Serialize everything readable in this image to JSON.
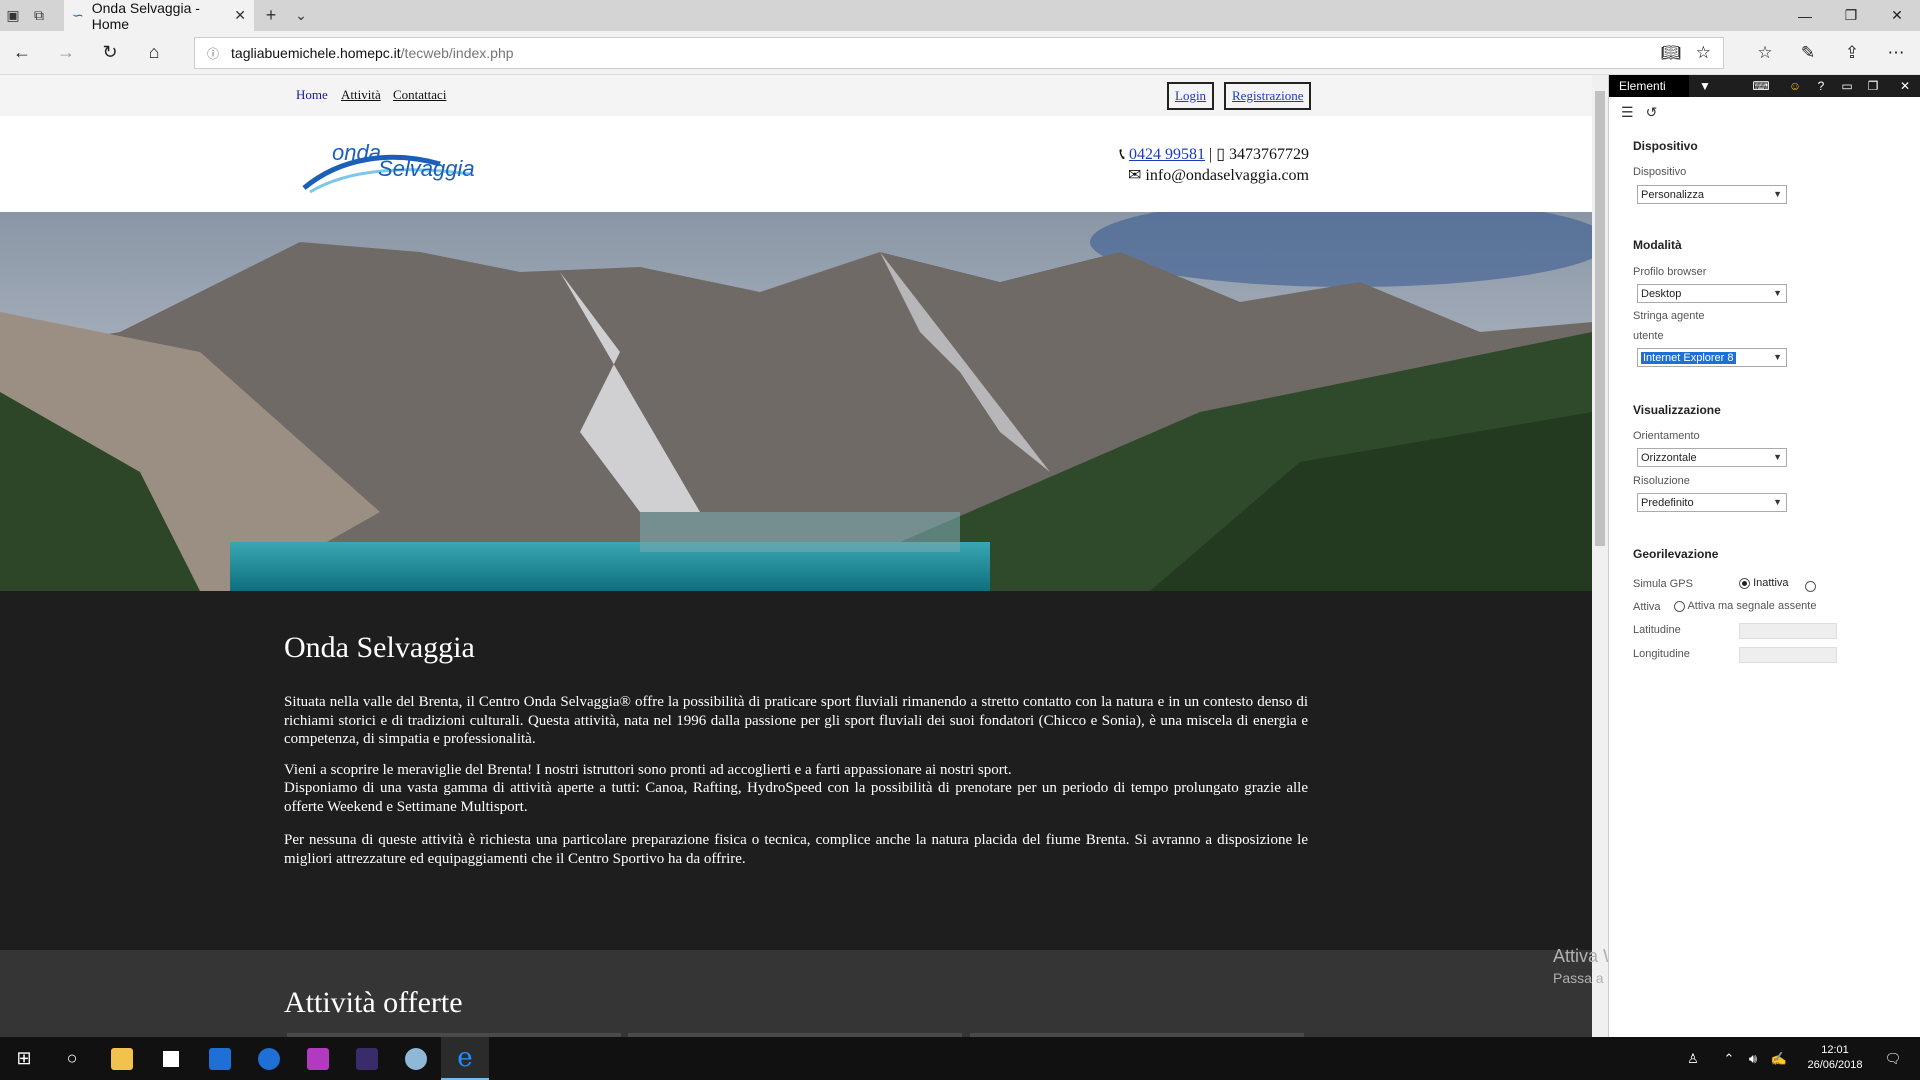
{
  "browser": {
    "tab_title": "Onda Selvaggia - Home",
    "url_host": "tagliabuemichele.homepc.it",
    "url_path": "/tecweb/index.php"
  },
  "site": {
    "nav": {
      "home": "Home",
      "attivita": "Attività",
      "contattaci": "Contattaci"
    },
    "auth": {
      "login": "Login",
      "registrazione": "Registrazione"
    },
    "logo": {
      "word1": "onda",
      "word2": "Selvaggia"
    },
    "contacts": {
      "phone": "0424 99581",
      "separator": "|",
      "mobile": "3473767729",
      "email": "info@ondaselvaggia.com"
    },
    "intro": {
      "title": "Onda Selvaggia",
      "p1": "Situata nella valle del Brenta, il Centro Onda Selvaggia® offre la possibilità di praticare sport fluviali rimanendo a stretto contatto con la natura e in un contesto denso di richiami storici e di tradizioni culturali. Questa attività, nata nel 1996 dalla passione per gli sport fluviali dei suoi fondatori (Chicco e Sonia), è una miscela di energia e competenza, di simpatia e professionalità.",
      "p2a": "Vieni a scoprire le meraviglie del Brenta! I nostri istruttori sono pronti ad accoglierti e a farti appassionare ai nostri sport.",
      "p2b": "Disponiamo di una vasta gamma di attività aperte a tutti: Canoa, Rafting, HydroSpeed con la possibilità di prenotare per un periodo di tempo prolungato grazie alle offerte Weekend e Settimane Multisport.",
      "p3": "Per nessuna di queste attività è richiesta una particolare preparazione fisica o tecnica, complice anche la natura placida del fiume Brenta. Si avranno a disposizione le migliori attrezzature ed equipaggiamenti che il Centro Sportivo ha da offrire."
    },
    "activities_title": "Attività offerte"
  },
  "watermark": {
    "title": "Attiva Windows",
    "sub": "Passa a Impostazioni per attivare Windows."
  },
  "devtools": {
    "tab": "Elementi",
    "dispositivo": {
      "section": "Dispositivo",
      "label": "Dispositivo",
      "value": "Personalizza"
    },
    "modalita": {
      "section": "Modalità",
      "profile_label": "Profilo browser",
      "profile_value": "Desktop",
      "ua_label_1": "Stringa agente",
      "ua_label_2": "utente",
      "ua_value": "Internet Explorer 8"
    },
    "visualizzazione": {
      "section": "Visualizzazione",
      "orient_label": "Orientamento",
      "orient_value": "Orizzontale",
      "res_label": "Risoluzione",
      "res_value": "Predefinito"
    },
    "geo": {
      "section": "Georilevazione",
      "gps_label": "Simula GPS",
      "opt_inactive": "Inattiva",
      "opt_active": "Attiva",
      "opt_no_signal": "Attiva ma segnale assente",
      "lat_label": "Latitudine",
      "lon_label": "Longitudine"
    }
  },
  "taskbar": {
    "time": "12:01",
    "date": "26/06/2018"
  },
  "colors": {
    "accent": "#1a3cb8",
    "dark_section": "#1e1e1e",
    "activities_bg": "#353535",
    "logo_blue": "#1b5fb8"
  }
}
